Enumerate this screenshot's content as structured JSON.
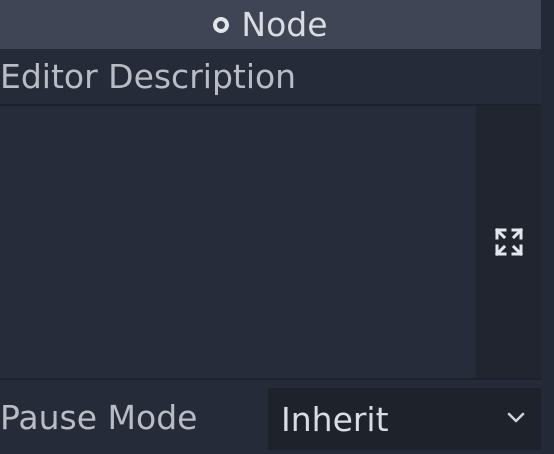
{
  "section": {
    "title": "Node",
    "icon": "node-circle-icon"
  },
  "editor_description": {
    "label": "Editor Description",
    "value": "",
    "expand_icon": "expand-icon"
  },
  "pause_mode": {
    "label": "Pause Mode",
    "selected": "Inherit",
    "dropdown_icon": "chevron-down-icon"
  }
}
